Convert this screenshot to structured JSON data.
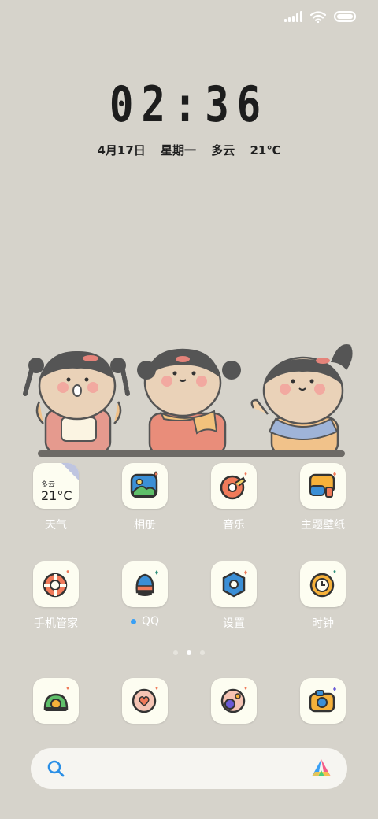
{
  "status_bar": {
    "signal_icon": "signal-icon",
    "wifi_icon": "wifi-icon",
    "battery_icon": "battery-icon"
  },
  "lockclock": {
    "time": "02:36",
    "date": "4月17日",
    "weekday": "星期一",
    "weather": "多云",
    "temperature": "21℃"
  },
  "apps_row1": [
    {
      "label": "天气",
      "icon": "weather-widget-icon"
    },
    {
      "label": "相册",
      "icon": "gallery-icon"
    },
    {
      "label": "音乐",
      "icon": "music-icon"
    },
    {
      "label": "主题壁纸",
      "icon": "theme-icon"
    }
  ],
  "weather_tile": {
    "condition": "多云",
    "temp": "21°C"
  },
  "apps_row2": [
    {
      "label": "手机管家",
      "icon": "security-icon"
    },
    {
      "label": "QQ",
      "icon": "qq-icon"
    },
    {
      "label": "设置",
      "icon": "settings-icon"
    },
    {
      "label": "时钟",
      "icon": "clock-icon"
    }
  ],
  "dock": [
    {
      "icon": "phone-icon"
    },
    {
      "icon": "messages-icon"
    },
    {
      "icon": "browser-icon"
    },
    {
      "icon": "camera-icon"
    }
  ],
  "page_indicator": {
    "pages": 3,
    "active": 2
  },
  "search": {
    "search_icon": "search-icon",
    "assistant_icon": "assistant-icon"
  },
  "colors": {
    "background": "#d6d3cb",
    "tile": "#fdfdf1",
    "qq_dot": "#3aa0f5",
    "search_accent": "#2b8fe6"
  }
}
